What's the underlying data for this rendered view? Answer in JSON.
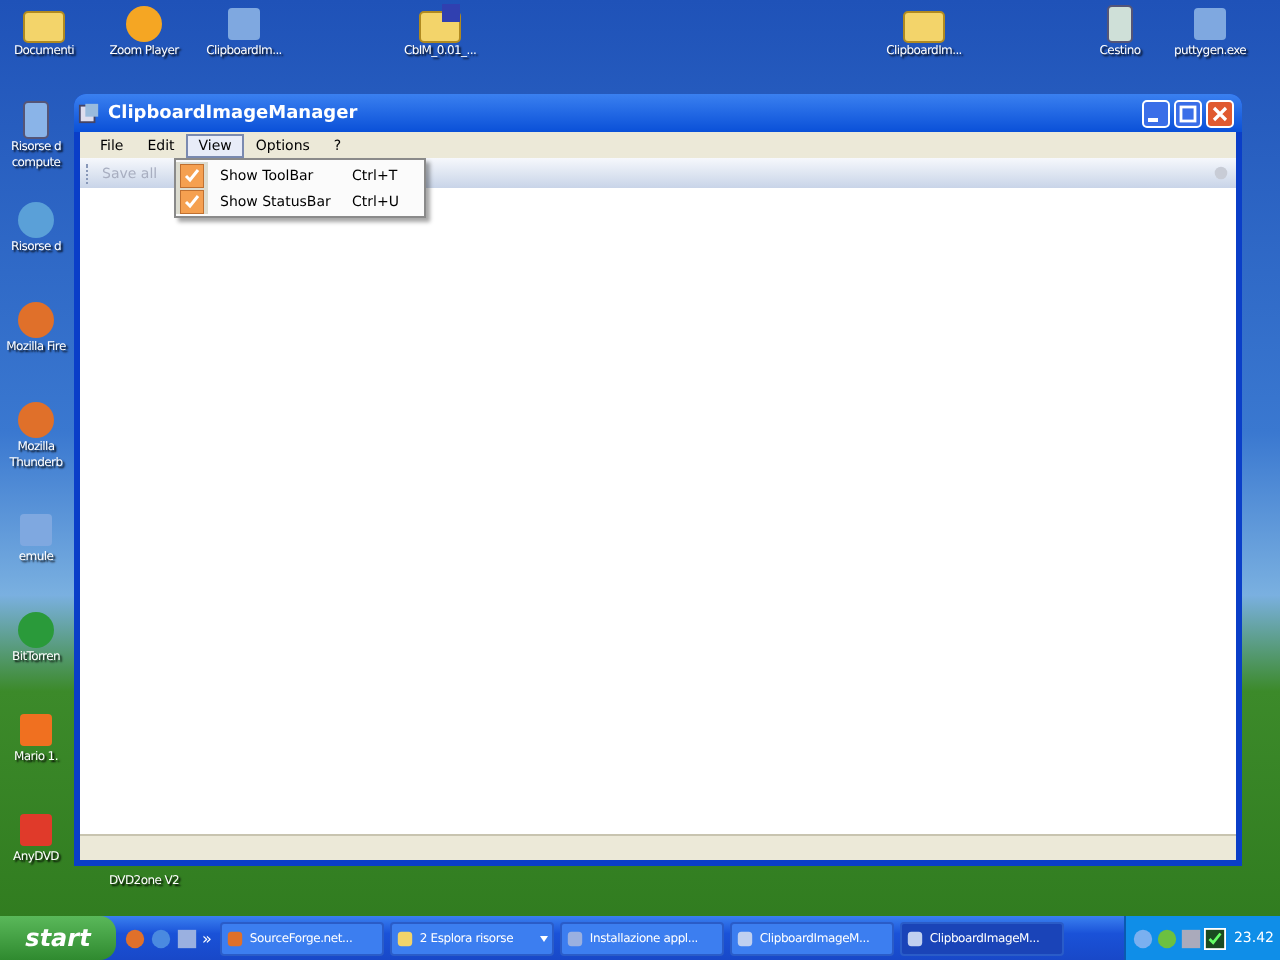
{
  "desktop_icons": [
    {
      "label": "Documenti",
      "kind": "folder"
    },
    {
      "label": "Zoom Player",
      "kind": "player"
    },
    {
      "label": "ClipboardIm...",
      "kind": "app"
    },
    {
      "label": "CbIM_0.01_...",
      "kind": "zip-folder"
    },
    {
      "label": "ClipboardIm...",
      "kind": "folder"
    },
    {
      "label": "Cestino",
      "kind": "recycle"
    },
    {
      "label": "puttygen.exe",
      "kind": "app"
    },
    {
      "label": "Risorse d\ncompute",
      "kind": "computer"
    },
    {
      "label": "Risorse d",
      "kind": "network"
    },
    {
      "label": "Mozilla Fire",
      "kind": "globe"
    },
    {
      "label": "Mozilla\nThunderb",
      "kind": "globe"
    },
    {
      "label": "emule",
      "kind": "app"
    },
    {
      "label": "BitTorren",
      "kind": "torrent"
    },
    {
      "label": "Mario 1.",
      "kind": "letter"
    },
    {
      "label": "AnyDVD",
      "kind": "fox"
    },
    {
      "label": "DVD2one V2",
      "kind": "none"
    }
  ],
  "window": {
    "title": "ClipboardImageManager",
    "menu": [
      {
        "label": "File",
        "selected": false
      },
      {
        "label": "Edit",
        "selected": false
      },
      {
        "label": "View",
        "selected": true
      },
      {
        "label": "Options",
        "selected": false
      },
      {
        "label": "?",
        "selected": false
      }
    ],
    "toolbar": [
      {
        "label": "Save all",
        "disabled": true
      }
    ],
    "open_menu": [
      {
        "label": "Show ToolBar",
        "shortcut": "Ctrl+T",
        "checked": true
      },
      {
        "label": "Show StatusBar",
        "shortcut": "Ctrl+U",
        "checked": true
      }
    ]
  },
  "taskbar": {
    "start": "start",
    "quick_launch_more": "»",
    "tasks": [
      {
        "label": "SourceForge.net...",
        "selected": false,
        "kind": "browser"
      },
      {
        "label": "2 Esplora risorse",
        "selected": false,
        "kind": "group"
      },
      {
        "label": "Installazione appl...",
        "selected": false,
        "kind": "setup"
      },
      {
        "label": "ClipboardImageM...",
        "selected": false,
        "kind": "app"
      },
      {
        "label": "ClipboardImageM...",
        "selected": true,
        "kind": "app"
      }
    ],
    "clock": "23.42"
  }
}
